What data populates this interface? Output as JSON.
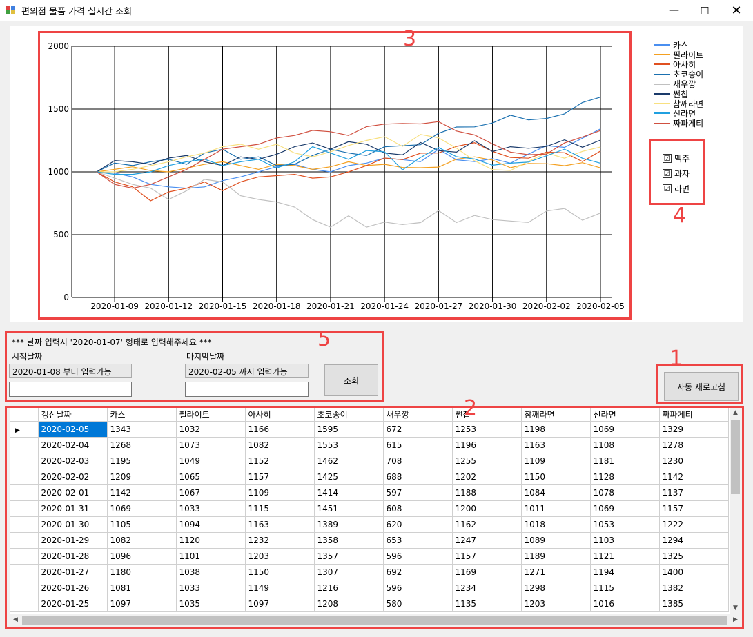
{
  "window": {
    "title": "편의점 물품 가격 실시간 조회"
  },
  "chart_data": {
    "type": "line",
    "x": [
      "2020-01-08",
      "2020-01-09",
      "2020-01-10",
      "2020-01-11",
      "2020-01-12",
      "2020-01-13",
      "2020-01-14",
      "2020-01-15",
      "2020-01-16",
      "2020-01-17",
      "2020-01-18",
      "2020-01-19",
      "2020-01-20",
      "2020-01-21",
      "2020-01-22",
      "2020-01-23",
      "2020-01-24",
      "2020-01-25",
      "2020-01-26",
      "2020-01-27",
      "2020-01-28",
      "2020-01-29",
      "2020-01-30",
      "2020-01-31",
      "2020-02-01",
      "2020-02-02",
      "2020-02-03",
      "2020-02-04",
      "2020-02-05"
    ],
    "xticks": [
      "2020-01-09",
      "2020-01-12",
      "2020-01-15",
      "2020-01-18",
      "2020-01-21",
      "2020-01-24",
      "2020-01-27",
      "2020-01-30",
      "2020-02-02",
      "2020-02-05"
    ],
    "ylim": [
      0,
      2000
    ],
    "yticks": [
      0,
      500,
      1000,
      1500,
      2000
    ],
    "grid": true,
    "legend_position": "right",
    "series": [
      {
        "name": "카스",
        "color": "#4a8ff0",
        "values": [
          1000,
          990,
          960,
          900,
          880,
          870,
          880,
          930,
          960,
          1000,
          1040,
          1060,
          1020,
          1000,
          1050,
          1070,
          1110,
          1097,
          1081,
          1180,
          1096,
          1082,
          1105,
          1069,
          1142,
          1209,
          1195,
          1268,
          1343
        ]
      },
      {
        "name": "필라이트",
        "color": "#f4a020",
        "values": [
          1000,
          1020,
          1040,
          1010,
          1000,
          1030,
          1060,
          1080,
          1050,
          1020,
          1060,
          1050,
          1020,
          1040,
          1080,
          1050,
          1060,
          1035,
          1033,
          1038,
          1101,
          1120,
          1094,
          1033,
          1067,
          1065,
          1049,
          1073,
          1032
        ]
      },
      {
        "name": "아사히",
        "color": "#e05020",
        "values": [
          1000,
          920,
          880,
          770,
          840,
          870,
          920,
          850,
          920,
          960,
          970,
          980,
          950,
          960,
          1000,
          1050,
          1110,
          1097,
          1149,
          1150,
          1203,
          1232,
          1163,
          1115,
          1109,
          1157,
          1152,
          1082,
          1166
        ]
      },
      {
        "name": "초코송이",
        "color": "#1a70b0",
        "values": [
          1000,
          1070,
          1050,
          1080,
          1100,
          1060,
          1150,
          1180,
          1100,
          1120,
          1050,
          1060,
          1130,
          1180,
          1150,
          1130,
          1200,
          1208,
          1216,
          1307,
          1357,
          1358,
          1389,
          1451,
          1414,
          1425,
          1462,
          1553,
          1595
        ]
      },
      {
        "name": "새우깡",
        "color": "#c0c0c0",
        "values": [
          1000,
          950,
          900,
          870,
          780,
          850,
          940,
          920,
          810,
          780,
          760,
          720,
          620,
          560,
          650,
          560,
          600,
          580,
          596,
          692,
          596,
          653,
          620,
          608,
          597,
          688,
          708,
          615,
          672
        ]
      },
      {
        "name": "썬칩",
        "color": "#1a3a6a",
        "values": [
          1000,
          1090,
          1080,
          1060,
          1110,
          1130,
          1080,
          1050,
          1120,
          1100,
          1140,
          1200,
          1230,
          1180,
          1240,
          1220,
          1150,
          1135,
          1234,
          1169,
          1157,
          1247,
          1162,
          1200,
          1188,
          1202,
          1255,
          1196,
          1253
        ]
      },
      {
        "name": "참깨라면",
        "color": "#f8e080",
        "values": [
          1000,
          1000,
          1020,
          1050,
          1080,
          1120,
          1150,
          1200,
          1220,
          1180,
          1220,
          1150,
          1120,
          1160,
          1210,
          1250,
          1280,
          1203,
          1298,
          1271,
          1189,
          1089,
          1018,
          1011,
          1084,
          1150,
          1109,
          1163,
          1198
        ]
      },
      {
        "name": "신라면",
        "color": "#20a0e0",
        "values": [
          1000,
          980,
          980,
          1000,
          1050,
          1080,
          1100,
          1050,
          1080,
          1100,
          1030,
          1080,
          1200,
          1150,
          1100,
          1170,
          1160,
          1016,
          1115,
          1194,
          1121,
          1103,
          1053,
          1069,
          1078,
          1128,
          1181,
          1108,
          1069
        ]
      },
      {
        "name": "짜파게티",
        "color": "#d05040",
        "values": [
          1000,
          900,
          870,
          900,
          960,
          1020,
          1100,
          1180,
          1200,
          1220,
          1270,
          1290,
          1330,
          1320,
          1290,
          1360,
          1380,
          1385,
          1382,
          1400,
          1325,
          1294,
          1222,
          1157,
          1137,
          1142,
          1230,
          1278,
          1329
        ]
      }
    ]
  },
  "filters": [
    {
      "label": "맥주",
      "checked": true
    },
    {
      "label": "과자",
      "checked": true
    },
    {
      "label": "라면",
      "checked": true
    }
  ],
  "checkmark": "☑",
  "query": {
    "hint": "*** 날짜 입력시 '2020-01-07' 형태로 입력해주세요 ***",
    "start_label": "시작날짜",
    "start_info": "2020-01-08 부터 입력가능",
    "start_value": "",
    "end_label": "마지막날짜",
    "end_info": "2020-02-05 까지 입력가능",
    "end_value": "",
    "search_button": "조회"
  },
  "auto_refresh_button": "자동 새로고침",
  "annotations": [
    "1",
    "2",
    "3",
    "4",
    "5"
  ],
  "table": {
    "columns": [
      "갱신날짜",
      "카스",
      "필라이트",
      "아사히",
      "초코송이",
      "새우깡",
      "썬칩",
      "참깨라면",
      "신라면",
      "짜파게티"
    ],
    "rows": [
      [
        "2020-02-05",
        "1343",
        "1032",
        "1166",
        "1595",
        "672",
        "1253",
        "1198",
        "1069",
        "1329"
      ],
      [
        "2020-02-04",
        "1268",
        "1073",
        "1082",
        "1553",
        "615",
        "1196",
        "1163",
        "1108",
        "1278"
      ],
      [
        "2020-02-03",
        "1195",
        "1049",
        "1152",
        "1462",
        "708",
        "1255",
        "1109",
        "1181",
        "1230"
      ],
      [
        "2020-02-02",
        "1209",
        "1065",
        "1157",
        "1425",
        "688",
        "1202",
        "1150",
        "1128",
        "1142"
      ],
      [
        "2020-02-01",
        "1142",
        "1067",
        "1109",
        "1414",
        "597",
        "1188",
        "1084",
        "1078",
        "1137"
      ],
      [
        "2020-01-31",
        "1069",
        "1033",
        "1115",
        "1451",
        "608",
        "1200",
        "1011",
        "1069",
        "1157"
      ],
      [
        "2020-01-30",
        "1105",
        "1094",
        "1163",
        "1389",
        "620",
        "1162",
        "1018",
        "1053",
        "1222"
      ],
      [
        "2020-01-29",
        "1082",
        "1120",
        "1232",
        "1358",
        "653",
        "1247",
        "1089",
        "1103",
        "1294"
      ],
      [
        "2020-01-28",
        "1096",
        "1101",
        "1203",
        "1357",
        "596",
        "1157",
        "1189",
        "1121",
        "1325"
      ],
      [
        "2020-01-27",
        "1180",
        "1038",
        "1150",
        "1307",
        "692",
        "1169",
        "1271",
        "1194",
        "1400"
      ],
      [
        "2020-01-26",
        "1081",
        "1033",
        "1149",
        "1216",
        "596",
        "1234",
        "1298",
        "1115",
        "1382"
      ],
      [
        "2020-01-25",
        "1097",
        "1035",
        "1097",
        "1208",
        "580",
        "1135",
        "1203",
        "1016",
        "1385"
      ]
    ]
  }
}
